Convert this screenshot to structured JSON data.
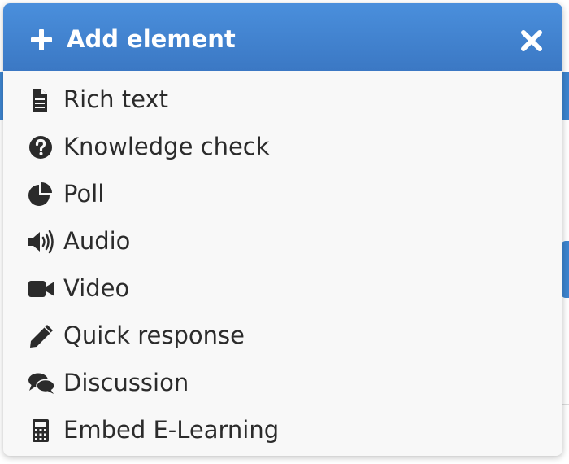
{
  "dialog": {
    "title": "Add element",
    "header_icon": "plus-icon",
    "close_icon": "close-icon",
    "header_color": "#3f83d3"
  },
  "items": [
    {
      "label": "Rich text",
      "icon": "document-icon"
    },
    {
      "label": "Knowledge check",
      "icon": "question-circle-icon"
    },
    {
      "label": "Poll",
      "icon": "pie-chart-icon"
    },
    {
      "label": "Audio",
      "icon": "speaker-icon"
    },
    {
      "label": "Video",
      "icon": "video-camera-icon"
    },
    {
      "label": "Quick response",
      "icon": "pencil-icon"
    },
    {
      "label": "Discussion",
      "icon": "comments-icon"
    },
    {
      "label": "Embed E-Learning",
      "icon": "calculator-icon"
    }
  ]
}
